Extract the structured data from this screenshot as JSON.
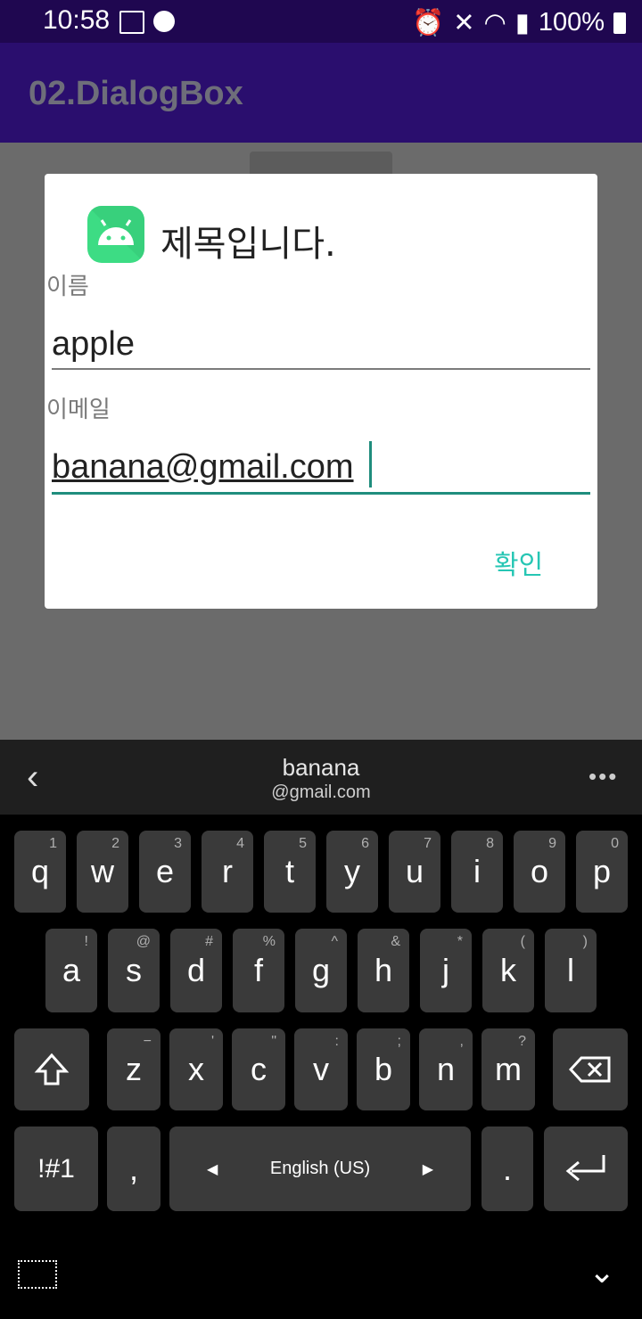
{
  "status_bar": {
    "time": "10:58",
    "battery": "100%"
  },
  "app_bar": {
    "title": "02.DialogBox"
  },
  "dialog": {
    "title": "제목입니다.",
    "fields": [
      {
        "label": "이름",
        "value": "apple"
      },
      {
        "label": "이메일",
        "value": "banana@gmail.com"
      }
    ],
    "ok_label": "확인"
  },
  "suggestion": {
    "line1": "banana",
    "line2": "@gmail.com"
  },
  "keyboard": {
    "row1": [
      {
        "k": "q",
        "h": "1"
      },
      {
        "k": "w",
        "h": "2"
      },
      {
        "k": "e",
        "h": "3"
      },
      {
        "k": "r",
        "h": "4"
      },
      {
        "k": "t",
        "h": "5"
      },
      {
        "k": "y",
        "h": "6"
      },
      {
        "k": "u",
        "h": "7"
      },
      {
        "k": "i",
        "h": "8"
      },
      {
        "k": "o",
        "h": "9"
      },
      {
        "k": "p",
        "h": "0"
      }
    ],
    "row2": [
      {
        "k": "a",
        "h": "!"
      },
      {
        "k": "s",
        "h": "@"
      },
      {
        "k": "d",
        "h": "#"
      },
      {
        "k": "f",
        "h": "%"
      },
      {
        "k": "g",
        "h": "^"
      },
      {
        "k": "h",
        "h": "&"
      },
      {
        "k": "j",
        "h": "*"
      },
      {
        "k": "k",
        "h": "("
      },
      {
        "k": "l",
        "h": ")"
      }
    ],
    "row3": [
      {
        "k": "z",
        "h": "−"
      },
      {
        "k": "x",
        "h": "'"
      },
      {
        "k": "c",
        "h": "\""
      },
      {
        "k": "v",
        "h": ":"
      },
      {
        "k": "b",
        "h": ";"
      },
      {
        "k": "n",
        "h": ","
      },
      {
        "k": "m",
        "h": "?"
      }
    ],
    "sym_label": "!#1",
    "comma": ",",
    "space_label": "English (US)",
    "period": "."
  }
}
